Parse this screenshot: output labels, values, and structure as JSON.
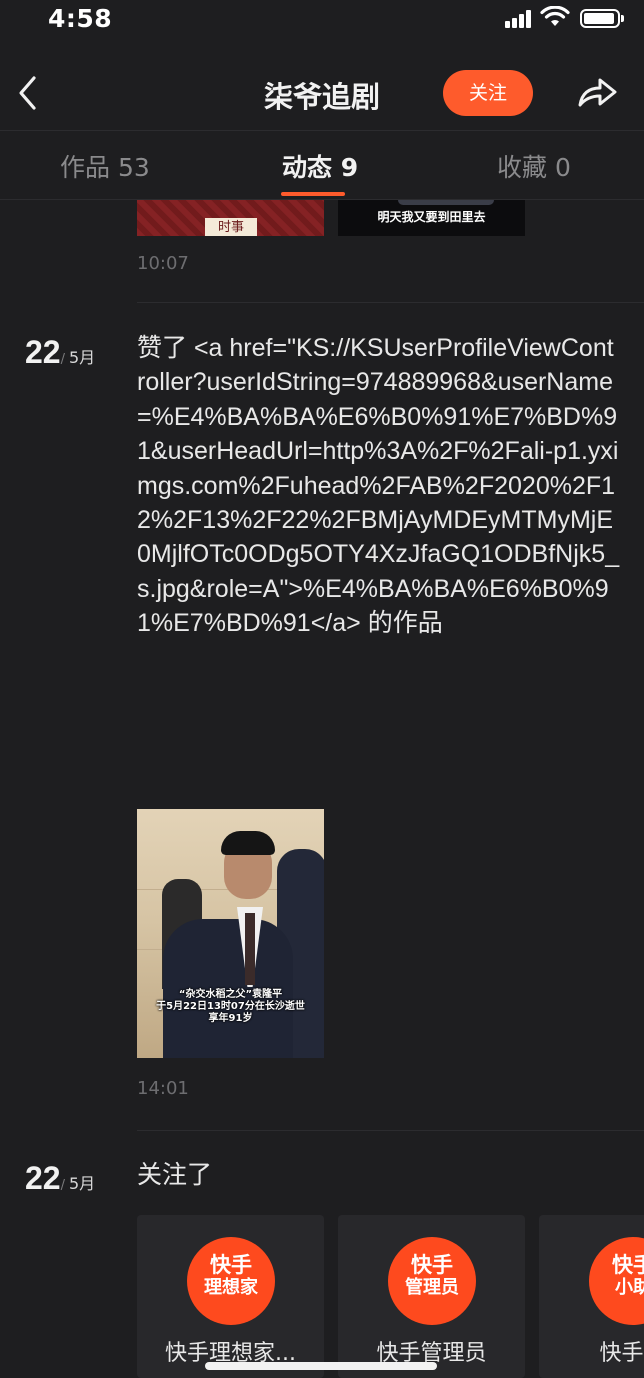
{
  "status_bar": {
    "time": "4:58"
  },
  "nav": {
    "title": "柒爷追剧",
    "follow_label": "关注"
  },
  "tabs": [
    {
      "label": "作品 53",
      "active": false
    },
    {
      "label": "动态 9",
      "active": true
    },
    {
      "label": "收藏 0",
      "active": false
    }
  ],
  "feed": {
    "top_item": {
      "left_thumb_text": "时事",
      "right_thumb_subtitle": "明天我又要到田里去",
      "time": "10:07"
    },
    "items": [
      {
        "date_day": "22",
        "date_month": "5月",
        "text": "赞了 <a href=\"KS://KSUserProfileViewController?userIdString=974889968&userName=%E4%BA%BA%E6%B0%91%E7%BD%91&userHeadUrl=http%3A%2F%2Fali-p1.yximgs.com%2Fuhead%2FAB%2F2020%2F12%2F13%2F22%2FBMjAyMDEyMTMyMjE0MjlfOTc0ODg5OTY4XzJfaGQ1ODBfNjk5_s.jpg&role=A\">%E4%BA%BA%E6%B0%91%E7%BD%91</a> 的作品",
        "video_caption": [
          "“杂交水稻之父”袁隆平",
          "于5月22日13时07分在长沙逝世",
          "享年91岁"
        ],
        "time": "14:01"
      },
      {
        "date_day": "22",
        "date_month": "5月",
        "text": "关注了",
        "users": [
          {
            "avatar_line1": "快手",
            "avatar_line2": "理想家",
            "name": "快手理想家..."
          },
          {
            "avatar_line1": "快手",
            "avatar_line2": "管理员",
            "name": "快手管理员"
          },
          {
            "avatar_line1": "快手",
            "avatar_line2": "小助",
            "name": "快手小"
          }
        ]
      }
    ]
  },
  "colors": {
    "background": "#1e1e20",
    "accent": "#fe5b2c",
    "muted_text": "#6d6d70",
    "card_bg": "#28282b"
  }
}
